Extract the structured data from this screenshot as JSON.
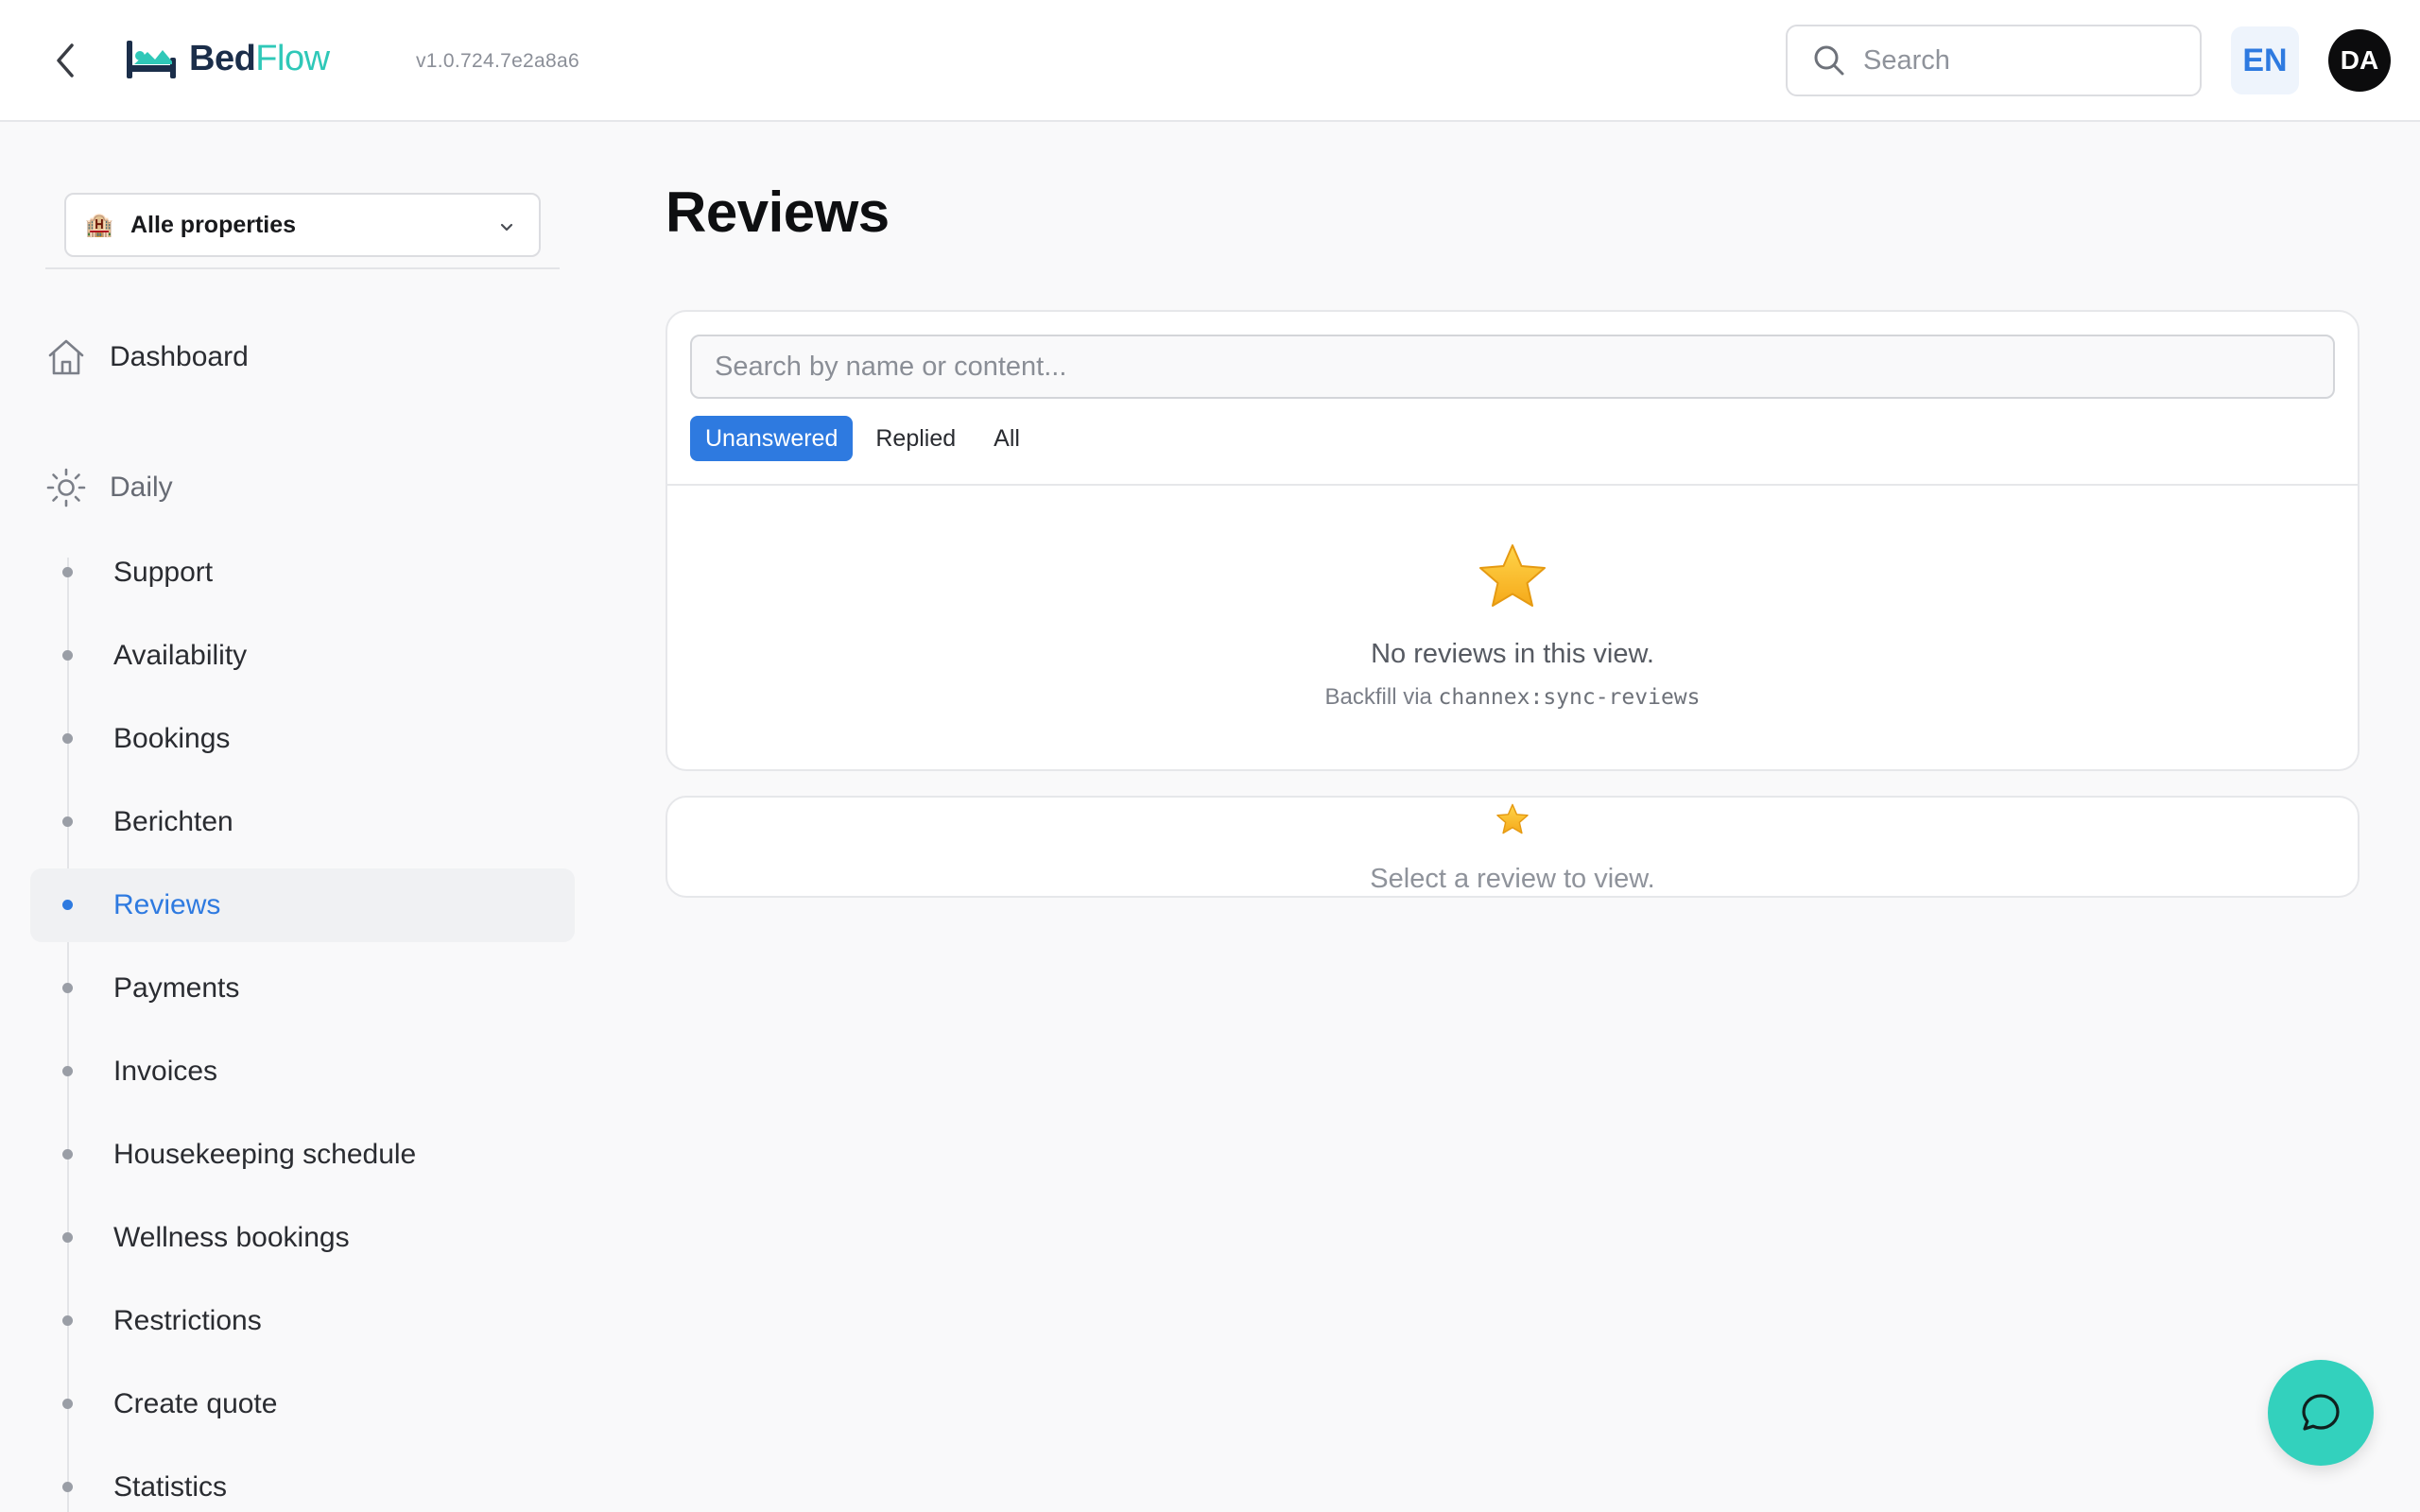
{
  "header": {
    "logo_bed": "Bed",
    "logo_flow": "Flow",
    "version": "v1.0.724.7e2a8a6",
    "search_placeholder": "Search",
    "language": "EN",
    "avatar_initials": "DA",
    "icons": {
      "back": "chevron-left-icon",
      "logo": "bed-icon",
      "search": "search-icon"
    }
  },
  "sidebar": {
    "property_selector": {
      "icon": "hotel-icon",
      "label": "Alle properties"
    },
    "dashboard": {
      "icon": "home-icon",
      "label": "Dashboard"
    },
    "section": {
      "icon": "sun-icon",
      "label": "Daily"
    },
    "items": [
      {
        "label": "Support",
        "active": false
      },
      {
        "label": "Availability",
        "active": false
      },
      {
        "label": "Bookings",
        "active": false
      },
      {
        "label": "Berichten",
        "active": false
      },
      {
        "label": "Reviews",
        "active": true
      },
      {
        "label": "Payments",
        "active": false
      },
      {
        "label": "Invoices",
        "active": false
      },
      {
        "label": "Housekeeping schedule",
        "active": false
      },
      {
        "label": "Wellness bookings",
        "active": false
      },
      {
        "label": "Restrictions",
        "active": false
      },
      {
        "label": "Create quote",
        "active": false
      },
      {
        "label": "Statistics",
        "active": false
      }
    ]
  },
  "main": {
    "title": "Reviews",
    "list": {
      "search_placeholder": "Search by name or content...",
      "tabs": [
        {
          "label": "Unanswered",
          "active": true
        },
        {
          "label": "Replied",
          "active": false
        },
        {
          "label": "All",
          "active": false
        }
      ],
      "empty_title": "No reviews in this view.",
      "empty_hint_prefix": "Backfill via ",
      "empty_hint_command": "channex:sync-reviews"
    },
    "detail": {
      "placeholder": "Select a review to view."
    }
  },
  "chat": {
    "icon": "chat-bubble-icon"
  },
  "colors": {
    "accent": "#2e7ae0",
    "brand_teal": "#2fc8b8",
    "chat_fab": "#33d1bd",
    "star": "#f5b921"
  }
}
